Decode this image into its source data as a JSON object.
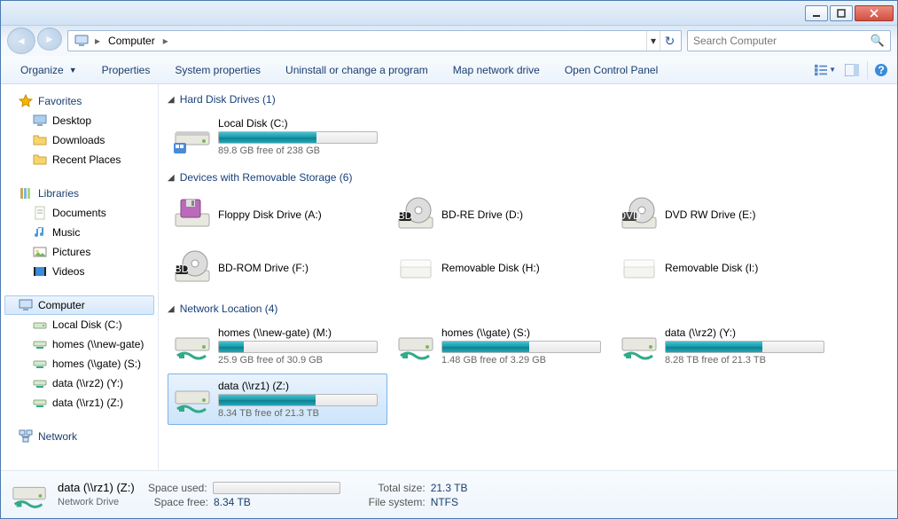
{
  "title": "",
  "breadcrumb": {
    "root": "Computer"
  },
  "search": {
    "placeholder": "Search Computer"
  },
  "toolbar": {
    "organize": "Organize",
    "properties": "Properties",
    "system_properties": "System properties",
    "uninstall": "Uninstall or change a program",
    "map_drive": "Map network drive",
    "control_panel": "Open Control Panel"
  },
  "sidebar": {
    "favorites": {
      "label": "Favorites",
      "items": [
        "Desktop",
        "Downloads",
        "Recent Places"
      ]
    },
    "libraries": {
      "label": "Libraries",
      "items": [
        "Documents",
        "Music",
        "Pictures",
        "Videos"
      ]
    },
    "computer": {
      "label": "Computer",
      "items": [
        "Local Disk (C:)",
        "homes (\\\\new-gate)",
        "homes (\\\\gate) (S:)",
        "data (\\\\rz2) (Y:)",
        "data (\\\\rz1) (Z:)"
      ]
    },
    "network": {
      "label": "Network"
    }
  },
  "sections": {
    "hdd": {
      "title": "Hard Disk Drives (1)",
      "items": [
        {
          "name": "Local Disk (C:)",
          "free": "89.8 GB free of 238 GB",
          "fill": 62
        }
      ]
    },
    "removable": {
      "title": "Devices with Removable Storage (6)",
      "items": [
        {
          "name": "Floppy Disk Drive (A:)"
        },
        {
          "name": "BD-RE Drive (D:)"
        },
        {
          "name": "DVD RW Drive (E:)"
        },
        {
          "name": "BD-ROM Drive (F:)"
        },
        {
          "name": "Removable Disk (H:)"
        },
        {
          "name": "Removable Disk (I:)"
        }
      ]
    },
    "network": {
      "title": "Network Location (4)",
      "items": [
        {
          "name": "homes (\\\\new-gate) (M:)",
          "free": "25.9 GB free of 30.9 GB",
          "fill": 16
        },
        {
          "name": "homes (\\\\gate) (S:)",
          "free": "1.48 GB free of 3.29 GB",
          "fill": 55
        },
        {
          "name": "data (\\\\rz2) (Y:)",
          "free": "8.28 TB free of 21.3 TB",
          "fill": 61
        },
        {
          "name": "data (\\\\rz1) (Z:)",
          "free": "8.34 TB free of 21.3 TB",
          "fill": 61,
          "selected": true
        }
      ]
    }
  },
  "details": {
    "name": "data (\\\\rz1) (Z:)",
    "type": "Network Drive",
    "used_label": "Space used:",
    "free_label": "Space free:",
    "free_val": "8.34 TB",
    "total_label": "Total size:",
    "total_val": "21.3 TB",
    "fs_label": "File system:",
    "fs_val": "NTFS"
  }
}
